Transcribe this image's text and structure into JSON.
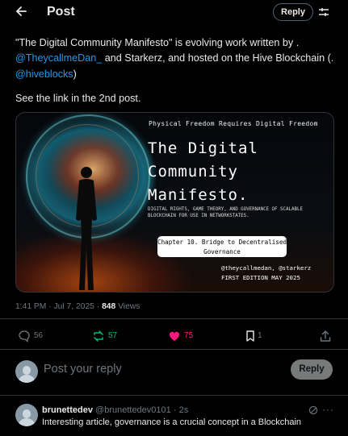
{
  "header": {
    "title": "Post",
    "back_icon": "arrow-left-icon",
    "reply_label": "Reply",
    "filter_icon": "sliders-icon"
  },
  "post": {
    "text_part1": "\"The Digital Community Manifesto\" is evolving work written by .",
    "mention1": "@TheycallmeDan_",
    "text_part2": " and Starkerz, and hosted on the Hive Blockchain (.",
    "mention2": "@hiveblocks",
    "text_part3": ")",
    "paragraph2": "See the link in the 2nd post.",
    "image": {
      "top_line": "Physical Freedom Requires Digital Freedom",
      "title_line1": "The Digital",
      "title_line2": "Community",
      "title_line3": "Manifesto.",
      "subtitle": "DIGITAL RIGHTS, GAME THEORY, AND GOVERNANCE OF SCALABLE BLOCKCHAIN FOR USE IN NETWORKSTATES.",
      "chapter_line1": "Chapter 10. Bridge to Decentralised",
      "chapter_line2": "Governance",
      "handles": "@theycallmedan, @starkerz",
      "edition": "FIRST EDITION MAY 2025"
    },
    "meta": {
      "time": "1:41 PM",
      "date": "Jul 7, 2025",
      "separator": " · ",
      "views_count": "848",
      "views_label": "Views"
    },
    "stats": {
      "replies": "56",
      "reposts": "57",
      "likes": "75",
      "bookmarks": "1"
    },
    "colors": {
      "accent": "#1d9bf0",
      "repost": "#00ba7c",
      "like": "#f91880",
      "muted": "#71767b"
    }
  },
  "compose": {
    "placeholder": "Post your reply",
    "button_label": "Reply"
  },
  "comment": {
    "name": "brunettedev",
    "handle": "@brunettedev0101",
    "time": "2s",
    "text": "Interesting article, governance is a crucial concept in a Blockchain"
  }
}
